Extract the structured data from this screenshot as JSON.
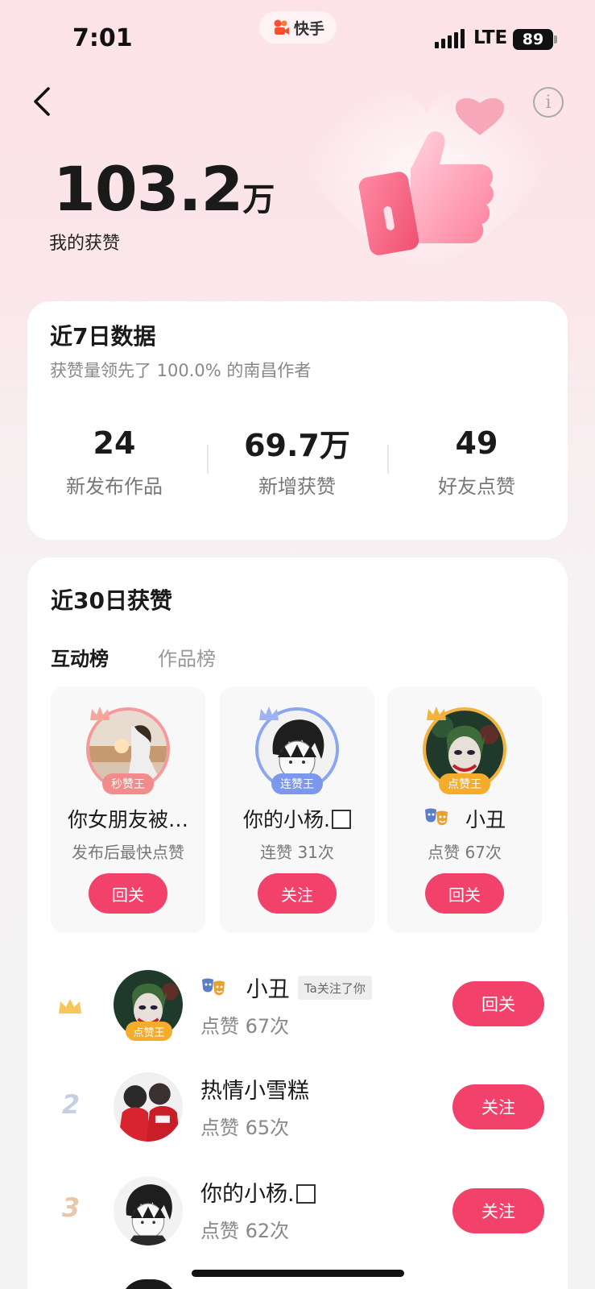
{
  "status_bar": {
    "time": "7:01",
    "app_name": "快手",
    "network": "LTE",
    "battery": "89"
  },
  "header": {
    "back_icon": "chevron-left-icon",
    "info_icon": "info-circle-icon",
    "likes_value": "103.2",
    "likes_unit": "万",
    "likes_label": "我的获赞"
  },
  "seven_day": {
    "title": "近7日数据",
    "subtitle": "获赞量领先了 100.0% 的南昌作者",
    "stats": [
      {
        "value": "24",
        "label": "新发布作品"
      },
      {
        "value": "69.7万",
        "label": "新增获赞"
      },
      {
        "value": "49",
        "label": "好友点赞"
      }
    ]
  },
  "thirty_day": {
    "title": "近30日获赞",
    "tabs": [
      {
        "label": "互动榜",
        "active": true
      },
      {
        "label": "作品榜",
        "active": false
      }
    ],
    "top3": [
      {
        "name": "你女朋友被…",
        "badge": "秒赞王",
        "desc": "发布后最快点赞",
        "button": "回关",
        "accent": "#f59a9a"
      },
      {
        "name": "你的小杨.",
        "badge": "连赞王",
        "desc": "连赞 31次",
        "button": "关注",
        "accent": "#8aa6f0"
      },
      {
        "name": "小丑",
        "badge": "点赞王",
        "desc": "点赞 67次",
        "button": "回关",
        "accent": "#f4b23c"
      }
    ],
    "list": [
      {
        "rank": "",
        "name": "小丑",
        "tag": "Ta关注了你",
        "count": "点赞 67次",
        "badge": "点赞王",
        "button": "回关"
      },
      {
        "rank": "2",
        "name": "热情小雪糕",
        "count": "点赞 65次",
        "button": "关注"
      },
      {
        "rank": "3",
        "name": "你的小杨.",
        "count": "点赞 62次",
        "button": "关注"
      }
    ]
  },
  "colors": {
    "accent": "#f2416b",
    "gold": "#f4b23c",
    "silver": "#c6d0e0",
    "bronze": "#e8c8a8"
  }
}
